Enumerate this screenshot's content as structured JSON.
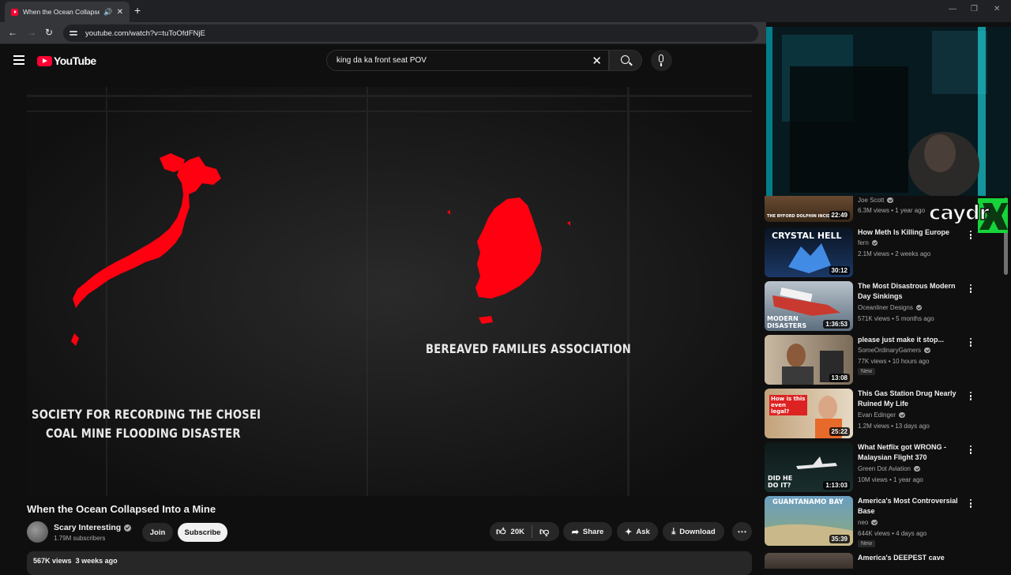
{
  "browser": {
    "tab_title": "When the Ocean Collapsed Into a Mine",
    "tab_audio_icon": "speaker-icon",
    "url": "youtube.com/watch?v=tuToOfdFNjE"
  },
  "youtube": {
    "logo_text": "YouTube",
    "search_value": "king da ka front seat  POV"
  },
  "video": {
    "overlay_text_right": "BEREAVED FAMILIES ASSOCIATION",
    "overlay_text_left_line1": "SOCIETY FOR RECORDING THE CHOSEI",
    "overlay_text_left_line2": "COAL MINE FLOODING DISASTER",
    "map_highlight_color": "#ff0010",
    "title": "When the Ocean Collapsed Into a Mine",
    "channel": "Scary Interesting",
    "subscribers": "1.79M subscribers",
    "join_label": "Join",
    "subscribe_label": "Subscribe",
    "likes": "20K",
    "share_label": "Share",
    "ask_label": "Ask",
    "download_label": "Download",
    "views": "567K views",
    "age": "3 weeks ago"
  },
  "recommendations": [
    {
      "title": "",
      "channel": "Joe Scott",
      "views": "6.3M views",
      "age": "1 year ago",
      "duration": "22:49",
      "thumb_text": "THE BYFORD DOLPHIN INCIDE",
      "is_new": false
    },
    {
      "title": "How Meth Is Killing Europe",
      "channel": "fern",
      "views": "2.1M views",
      "age": "2 weeks ago",
      "duration": "30:12",
      "thumb_text": "CRYSTAL HELL",
      "is_new": false
    },
    {
      "title": "The Most Disastrous Modern Day Sinkings",
      "channel": "Oceanliner Designs",
      "views": "571K views",
      "age": "5 months ago",
      "duration": "1:36:53",
      "thumb_text": "MODERN DISASTERS",
      "is_new": false
    },
    {
      "title": "please just make it stop...",
      "channel": "SomeOrdinaryGamers",
      "views": "77K views",
      "age": "10 hours ago",
      "duration": "13:08",
      "thumb_text": "",
      "is_new": true
    },
    {
      "title": "This Gas Station Drug Nearly Ruined My Life",
      "channel": "Evan Edinger",
      "views": "1.2M views",
      "age": "13 days ago",
      "duration": "25:22",
      "thumb_text": "How is this even legal?",
      "is_new": false
    },
    {
      "title": "What Netflix got WRONG - Malaysian Flight 370",
      "channel": "Green Dot Aviation",
      "views": "10M views",
      "age": "1 year ago",
      "duration": "1:13:03",
      "thumb_text": "DID HE DO IT?",
      "is_new": false
    },
    {
      "title": "America's Most Controversial Base",
      "channel": "neo",
      "views": "644K views",
      "age": "4 days ago",
      "duration": "35:39",
      "thumb_text": "GUANTANAMO BAY",
      "is_new": true
    },
    {
      "title": "America's DEEPEST cave",
      "channel": "",
      "views": "",
      "age": "",
      "duration": "",
      "thumb_text": "",
      "is_new": false
    }
  ],
  "new_badge": "New",
  "webcam_overlay_text": "caydr"
}
